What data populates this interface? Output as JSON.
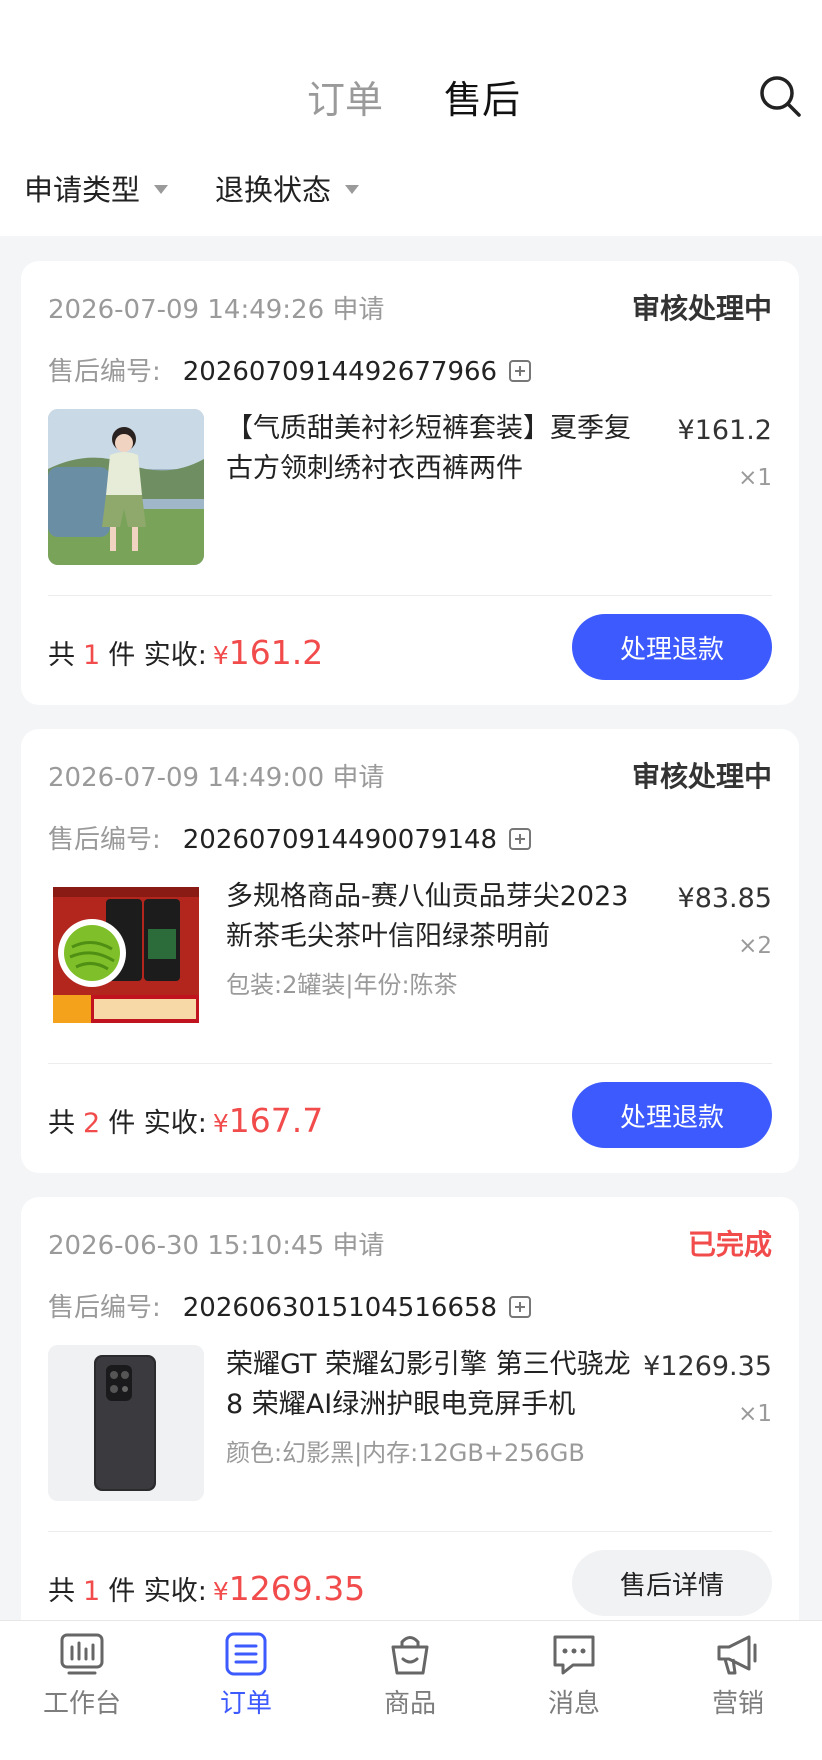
{
  "header": {
    "tabs": [
      {
        "label": "订单",
        "active": false
      },
      {
        "label": "售后",
        "active": true
      }
    ],
    "search_icon": "search-icon"
  },
  "filters": [
    {
      "label": "申请类型"
    },
    {
      "label": "退换状态"
    }
  ],
  "colors": {
    "accent": "#3d5afe",
    "price": "#f14b4b",
    "muted": "#9a9a9a"
  },
  "orders": [
    {
      "date": "2026-07-09 14:49:26 申请",
      "status": "审核处理中",
      "sn_label": "售后编号:",
      "sn": "2026070914492677966",
      "title": "【气质甜美衬衫短裤套装】夏季复古方领刺绣衬衣西裤两件",
      "spec": "",
      "price": "¥161.2",
      "qty": "×1",
      "total_prefix": "共",
      "count": "1",
      "total_mid": "件 实收:",
      "yen": "¥",
      "amount": "161.2",
      "button": "处理退款"
    },
    {
      "date": "2026-07-09 14:49:00 申请",
      "status": "审核处理中",
      "sn_label": "售后编号:",
      "sn": "2026070914490079148",
      "title": "多规格商品-赛八仙贡品芽尖2023新茶毛尖茶叶信阳绿茶明前",
      "spec": "包装:2罐装|年份:陈茶",
      "price": "¥83.85",
      "qty": "×2",
      "total_prefix": "共",
      "count": "2",
      "total_mid": "件 实收:",
      "yen": "¥",
      "amount": "167.7",
      "button": "处理退款"
    },
    {
      "date": "2026-06-30 15:10:45 申请",
      "status": "已完成",
      "sn_label": "售后编号:",
      "sn": "2026063015104516658",
      "title": "荣耀GT 荣耀幻影引擎 第三代骁龙8 荣耀AI绿洲护眼电竞屏手机",
      "spec": "颜色:幻影黑|内存:12GB+256GB",
      "price": "¥1269.35",
      "qty": "×1",
      "total_prefix": "共",
      "count": "1",
      "total_mid": "件 实收:",
      "yen": "¥",
      "amount": "1269.35",
      "button": "售后详情"
    }
  ],
  "tabbar": [
    {
      "label": "工作台",
      "icon": "dashboard-icon",
      "active": false
    },
    {
      "label": "订单",
      "icon": "order-list-icon",
      "active": true
    },
    {
      "label": "商品",
      "icon": "shopping-bag-icon",
      "active": false
    },
    {
      "label": "消息",
      "icon": "message-icon",
      "active": false
    },
    {
      "label": "营销",
      "icon": "megaphone-icon",
      "active": false
    }
  ]
}
